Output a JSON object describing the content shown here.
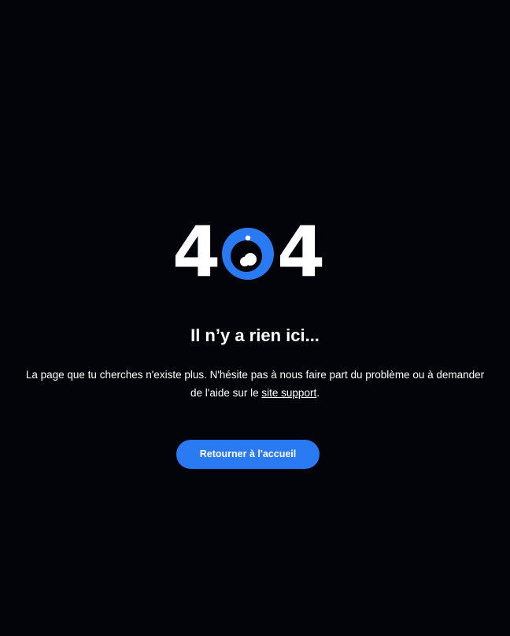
{
  "error_graphic": {
    "digit_left": "4",
    "digit_right": "4",
    "center_icon": "eye-icon",
    "accent_color": "#2a7af3"
  },
  "headline": "Il n’y a rien ici...",
  "message": {
    "text_before": "La page que tu cherches n'existe plus. N'hésite pas à nous faire part du problème ou à demander de l'aide sur le ",
    "link_text": "site support",
    "text_after": "."
  },
  "button": {
    "label": "Retourner à l'accueil"
  },
  "colors": {
    "background": "#03040a",
    "text": "#ffffff",
    "accent": "#2a7af3"
  }
}
